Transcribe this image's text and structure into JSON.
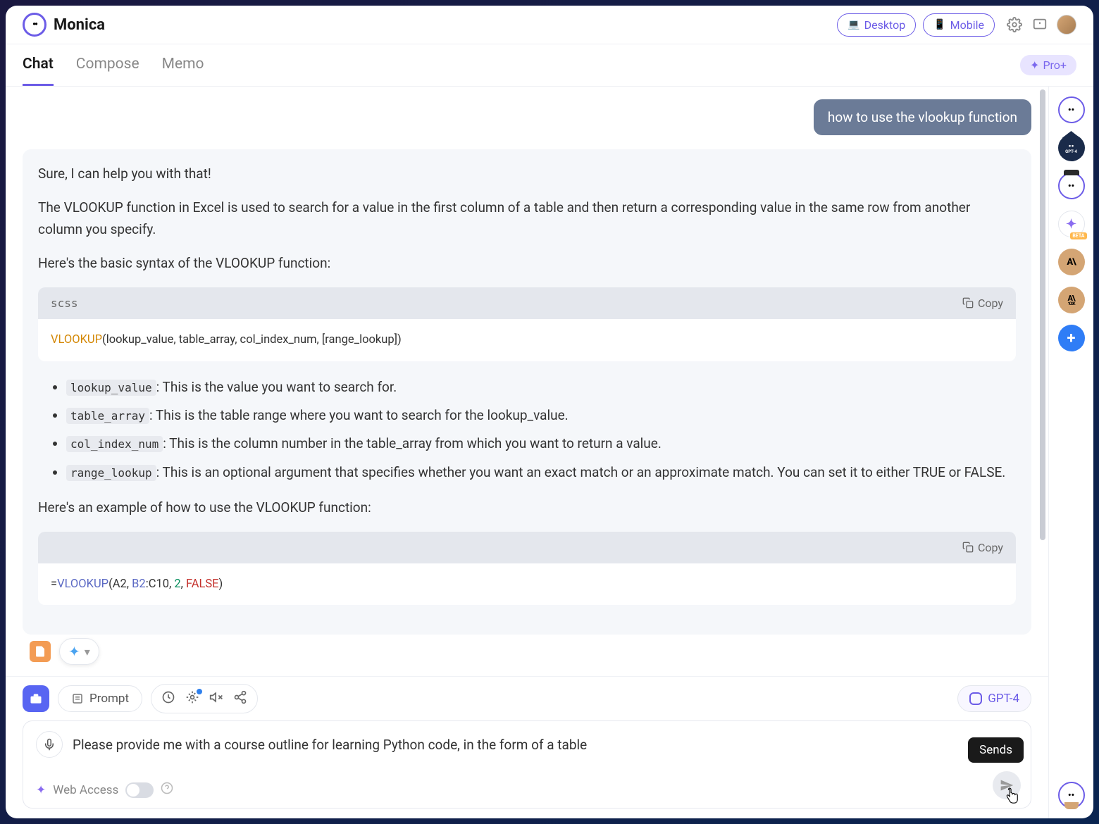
{
  "header": {
    "app_name": "Monica",
    "desktop": "Desktop",
    "mobile": "Mobile"
  },
  "tabs": {
    "chat": "Chat",
    "compose": "Compose",
    "memo": "Memo",
    "pro": "Pro+"
  },
  "chat": {
    "user_msg": "how to use the vlookup function",
    "bot": {
      "p1": "Sure, I can help you with that!",
      "p2": "The VLOOKUP function in Excel is used to search for a value in the first column of a table and then return a corresponding value in the same row from another column you specify.",
      "p3": "Here's the basic syntax of the VLOOKUP function:",
      "code1_lang": "scss",
      "copy": "Copy",
      "code1": {
        "fn": "VLOOKUP",
        "args": "(lookup_value, table_array, col_index_num, [range_lookup])"
      },
      "params": [
        {
          "name": "lookup_value",
          "desc": ": This is the value you want to search for."
        },
        {
          "name": "table_array",
          "desc": ": This is the table range where you want to search for the lookup_value."
        },
        {
          "name": "col_index_num",
          "desc": ": This is the column number in the table_array from which you want to return a value."
        },
        {
          "name": "range_lookup",
          "desc": ": This is an optional argument that specifies whether you want an exact match or an approximate match. You can set it to either TRUE or FALSE."
        }
      ],
      "p4": "Here's an example of how to use the VLOOKUP function:",
      "code2": {
        "eq": "=",
        "fn": "VLOOKUP",
        "open": "(A2, ",
        "range": "B2",
        "colon": ":C10, ",
        "num": "2",
        "comma2": ", ",
        "kw": "FALSE",
        "close": ")"
      }
    }
  },
  "input": {
    "prompt_label": "Prompt",
    "model": "GPT-4",
    "value": "Please provide me with a course outline for learning Python code, in the form of a table",
    "web_access": "Web Access",
    "tooltip": "Sends"
  },
  "rail": {
    "gpt4": "GPT-4",
    "ant": "A\\",
    "ant2_top": "A\\",
    "ant2_sub": "100K",
    "beta": "BETA"
  }
}
